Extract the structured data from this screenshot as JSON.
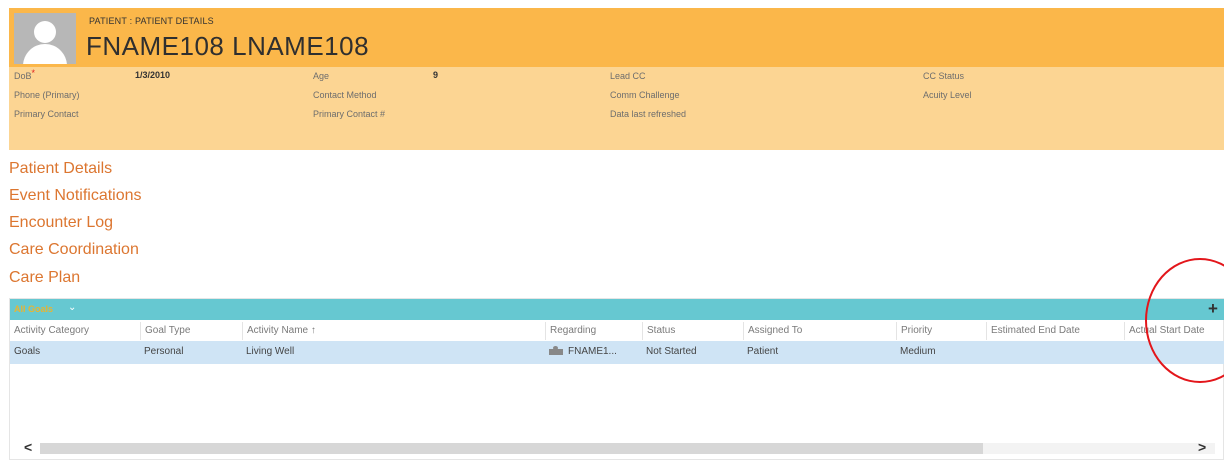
{
  "header": {
    "entity_label": "PATIENT : PATIENT DETAILS",
    "patient_name": "FNAME108 LNAME108",
    "avatar_icon": "user-silhouette-icon",
    "fields": {
      "dob_label": "DoB",
      "dob_required_mark": "*",
      "dob_value": "1/3/2010",
      "age_label": "Age",
      "age_value": "9",
      "lead_cc_label": "Lead CC",
      "cc_status_label": "CC Status",
      "phone_label": "Phone (Primary)",
      "contact_method_label": "Contact Method",
      "comm_challenge_label": "Comm Challenge",
      "acuity_level_label": "Acuity Level",
      "primary_contact_label": "Primary Contact",
      "primary_contact_num_label": "Primary Contact #",
      "data_last_refreshed_label": "Data last refreshed"
    }
  },
  "nav": {
    "items": [
      "Patient Details",
      "Event Notifications",
      "Encounter Log",
      "Care Coordination",
      "Care Plan"
    ]
  },
  "grid": {
    "view_name": "All Goals",
    "view_chevron": "⌄",
    "add_symbol": "+",
    "columns": [
      "Activity Category",
      "Goal Type",
      "Activity Name ↑",
      "Regarding",
      "Status",
      "Assigned To",
      "Priority",
      "Estimated End Date",
      "Actual Start Date"
    ],
    "rows": [
      {
        "activity_category": "Goals",
        "goal_type": "Personal",
        "activity_name": "Living Well",
        "regarding": "FNAME1...",
        "status": "Not Started",
        "assigned_to": "Patient",
        "priority": "Medium"
      }
    ],
    "scroll_left": "<",
    "scroll_right": ">"
  },
  "colors": {
    "header_dark": "#fbb74a",
    "header_light": "#fcd593",
    "nav_link": "#dc7630",
    "grid_bar": "#66c8d1",
    "selected_row": "#cfe4f5",
    "annotation_circle": "#e3161b"
  }
}
